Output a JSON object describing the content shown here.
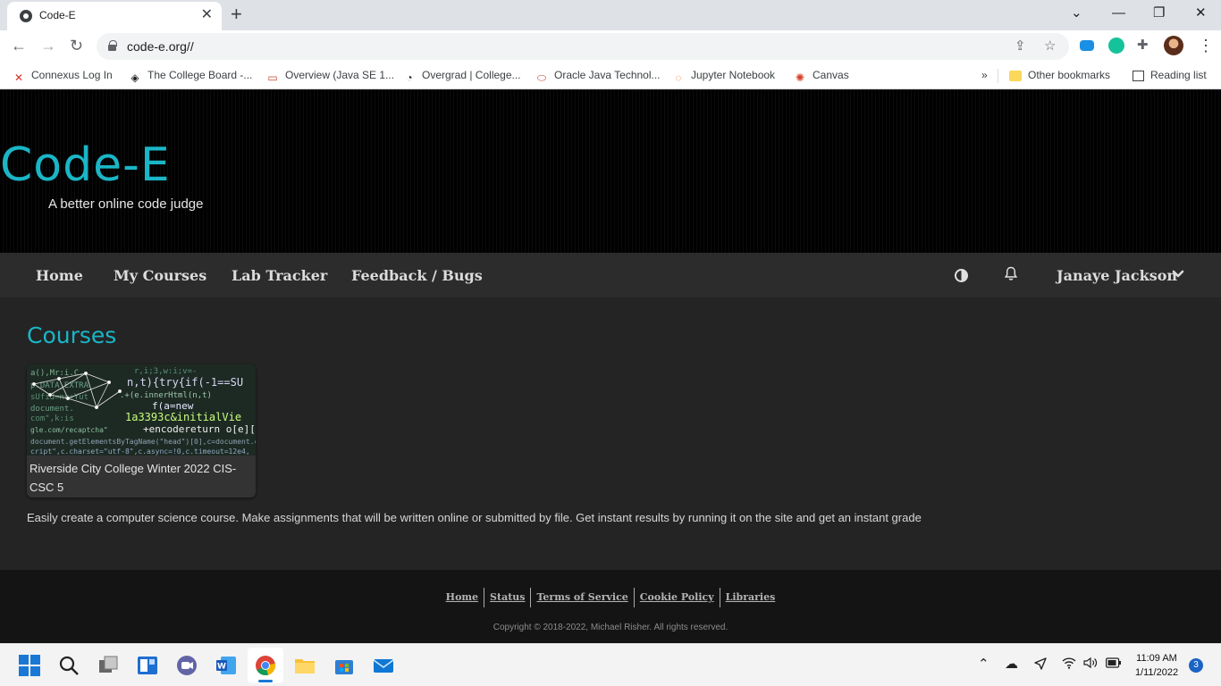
{
  "browser": {
    "tab_title": "Code-E",
    "tab_close": "✕",
    "new_tab": "+",
    "url": "code-e.org//",
    "window": {
      "dropdown": "⌄",
      "minimize": "—",
      "restore": "❐",
      "close": "✕"
    },
    "nav": {
      "back": "←",
      "forward": "→",
      "reload": "↻"
    },
    "omnibox_icons": {
      "share": "⇪",
      "star": "☆"
    },
    "profile_colors": {
      "onedrive": "#1a8fe3",
      "grammarly": "#15c39a",
      "avatar": "#b0653c"
    }
  },
  "bookmarks": [
    {
      "label": "Connexus Log In",
      "icon": "connexus-icon",
      "glyph": "✕",
      "color": "#d93025"
    },
    {
      "label": "The College Board -...",
      "icon": "college-board-icon",
      "glyph": "◈",
      "color": "#222"
    },
    {
      "label": "Overview (Java SE 1...",
      "icon": "oracle-icon",
      "glyph": "▭",
      "color": "#c74634"
    },
    {
      "label": "Overgrad | College...",
      "icon": "overgrad-icon",
      "glyph": "◔",
      "color": "#222"
    },
    {
      "label": "Oracle Java Technol...",
      "icon": "oracle-icon",
      "glyph": "⬭",
      "color": "#c74634"
    },
    {
      "label": "Jupyter Notebook",
      "icon": "jupyter-icon",
      "glyph": "◌",
      "color": "#f37726"
    },
    {
      "label": "Canvas",
      "icon": "canvas-icon",
      "glyph": "✺",
      "color": "#d64027"
    }
  ],
  "bookmarks_overflow": "»",
  "other_bookmarks": "Other bookmarks",
  "reading_list": "Reading list",
  "site": {
    "brand": "Code-E",
    "tagline": "A better online code judge",
    "accent_color": "#1ab6c7",
    "nav": [
      "Home",
      "My Courses",
      "Lab Tracker",
      "Feedback / Bugs"
    ],
    "user_name": "Janaye Jackson",
    "user_chevron": "❯",
    "bell": "🔔",
    "courses_heading": "Courses",
    "course_card": {
      "name": "Riverside City College Winter 2022 CIS-CSC 5"
    },
    "intro": "Easily create a computer science course. Make assignments that will be written online or submitted by file. Get instant results by running it on the site and get an instant grade",
    "footer_links": [
      "Home",
      "Status",
      "Terms of Service",
      "Cookie Policy",
      "Libraries"
    ],
    "copyright": "Copyright © 2018-2022, Michael Risher. All rights reserved."
  },
  "taskbar": {
    "time": "11:09 AM",
    "date": "1/11/2022",
    "notification_count": "3",
    "tray": {
      "chevron": "⌃",
      "cloud": "☁",
      "location": "➤",
      "wifi": "◠",
      "volume": "◖",
      "battery": "▭"
    }
  }
}
